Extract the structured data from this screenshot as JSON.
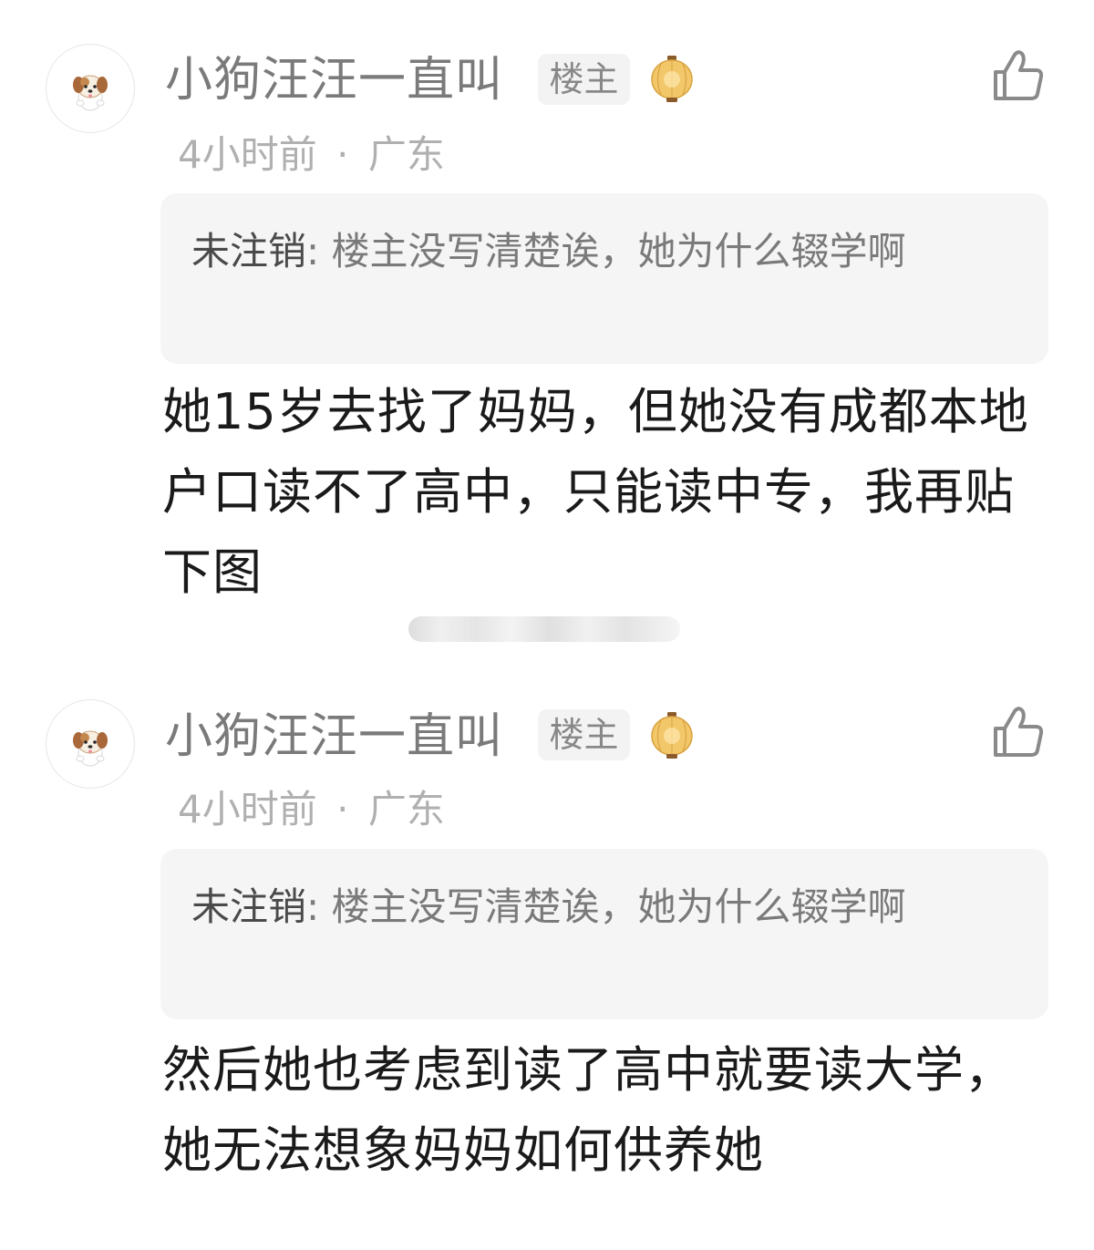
{
  "comments": [
    {
      "username": "小狗汪汪一直叫",
      "badge": "楼主",
      "time": "4小时前",
      "separator": "·",
      "location": "广东",
      "quote_author": "未注销",
      "quote_colon": ": ",
      "quote_text": "楼主没写清楚诶，她为什么辍学啊",
      "reply": "她15岁去找了妈妈，但她没有成都本地户口读不了高中，只能读中专，我再贴下图",
      "avatar_icon": "puppy-avatar-icon",
      "badge_icon": "lantern-icon",
      "like_icon": "thumbs-up-icon"
    },
    {
      "username": "小狗汪汪一直叫",
      "badge": "楼主",
      "time": "4小时前",
      "separator": "·",
      "location": "广东",
      "quote_author": "未注销",
      "quote_colon": ": ",
      "quote_text": "楼主没写清楚诶，她为什么辍学啊",
      "reply": "然后她也考虑到读了高中就要读大学，她无法想象妈妈如何供养她",
      "avatar_icon": "puppy-avatar-icon",
      "badge_icon": "lantern-icon",
      "like_icon": "thumbs-up-icon"
    }
  ],
  "colors": {
    "username": "#7a7a7a",
    "meta": "#b0b0b0",
    "quote_bg": "#f5f5f5",
    "reply_text": "#1a1a1a",
    "lantern": "#e8b24a"
  }
}
